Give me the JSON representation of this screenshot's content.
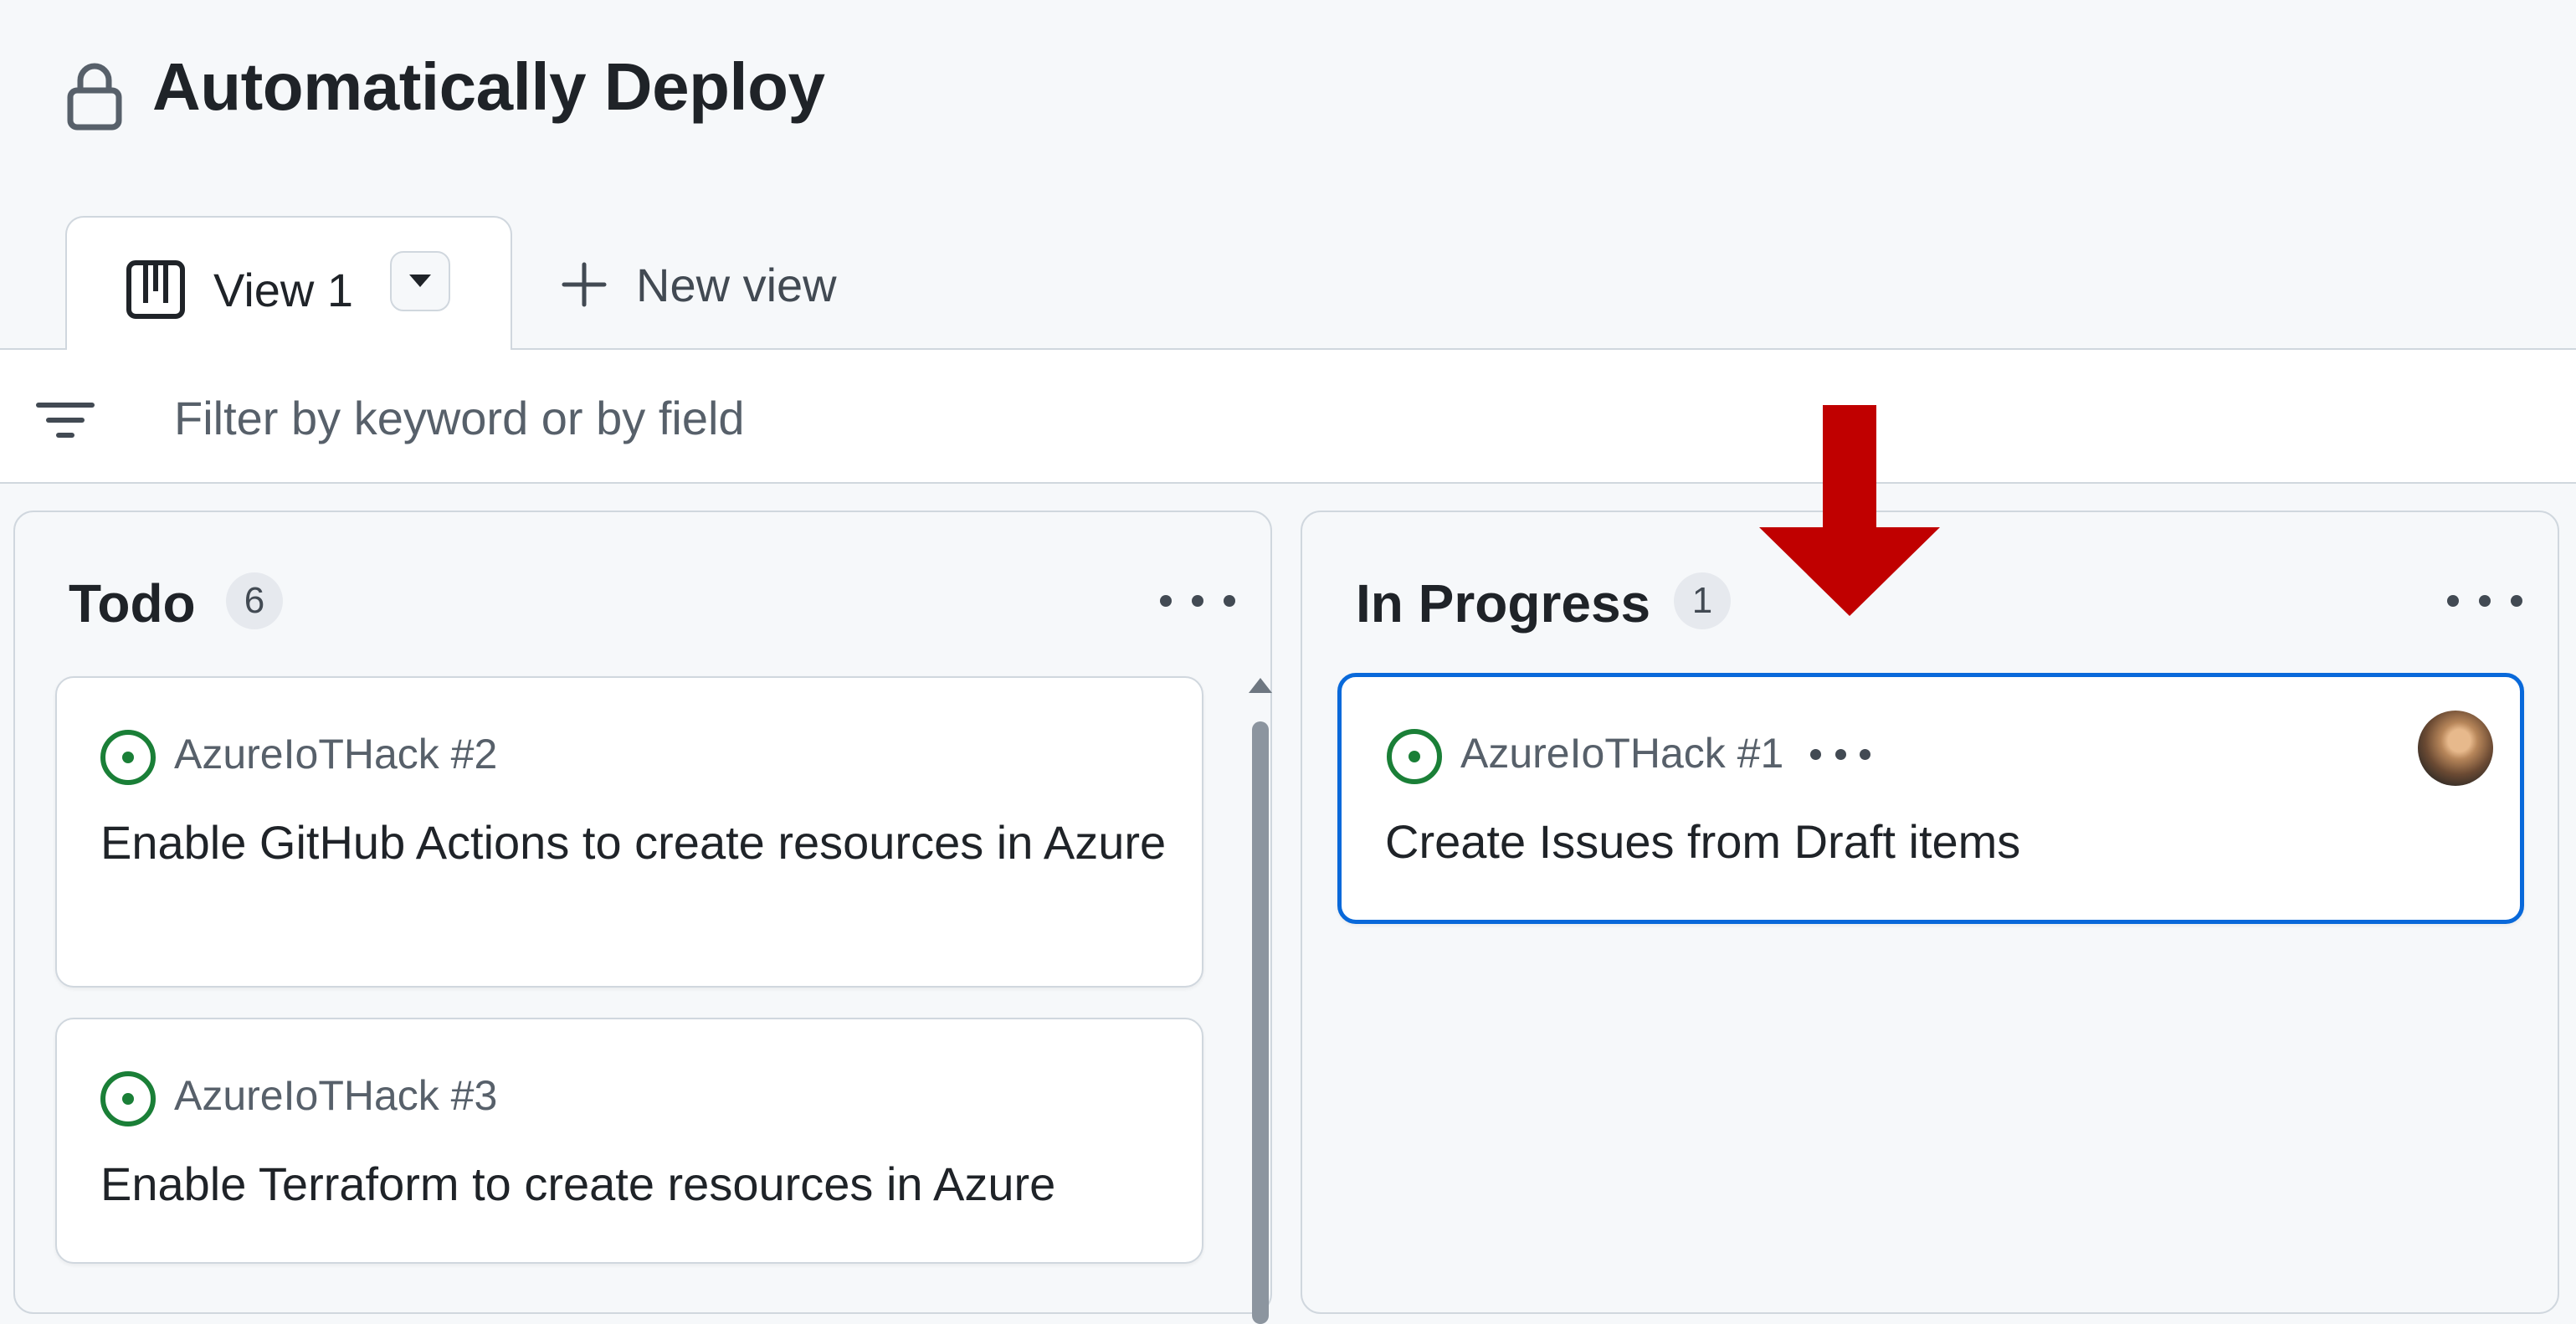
{
  "project": {
    "title": "Automatically Deploy"
  },
  "tabs": {
    "active_label": "View 1",
    "new_view_label": "New view"
  },
  "filter": {
    "placeholder": "Filter by keyword or by field"
  },
  "columns": [
    {
      "title": "Todo",
      "count": "6",
      "cards": [
        {
          "ref": "AzureIoTHack #2",
          "title": "Enable GitHub Actions to create resources in Azure",
          "status": "open"
        },
        {
          "ref": "AzureIoTHack #3",
          "title": "Enable Terraform to create resources in Azure",
          "status": "open"
        }
      ]
    },
    {
      "title": "In Progress",
      "count": "1",
      "cards": [
        {
          "ref": "AzureIoTHack #1",
          "title": "Create Issues from Draft items",
          "status": "open",
          "selected": true,
          "has_assignee_avatar": true
        }
      ]
    }
  ],
  "colors": {
    "accent": "#0969da",
    "open_issue": "#1a7f37",
    "annotation_arrow": "#c00000",
    "page_bg": "#f6f8fa"
  },
  "icons": {
    "project": "lock-icon",
    "view": "board-icon",
    "tab_dropdown": "triangle-down-icon",
    "new_view": "plus-icon",
    "filter": "filter-icon",
    "column_menu": "kebab-horizontal-icon",
    "issue_status": "issue-opened-icon",
    "annotation": "red-down-arrow"
  }
}
